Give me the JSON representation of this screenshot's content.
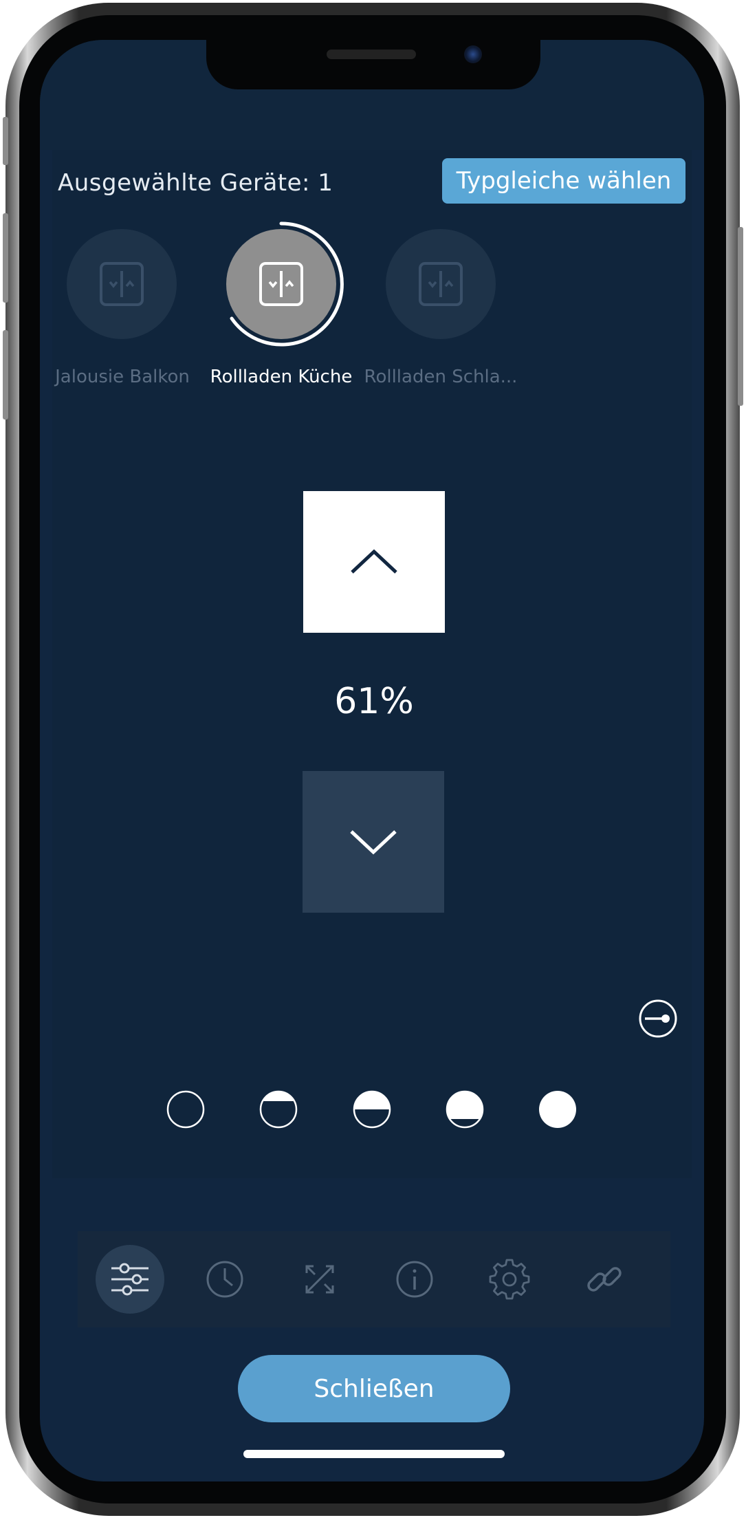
{
  "header": {
    "selected_count": "Ausgewählte Geräte: 1",
    "select_same_type_label": "Typgleiche wählen"
  },
  "devices": [
    {
      "label": "Jalousie Balkon",
      "selected": false,
      "icon": "shutter-icon"
    },
    {
      "label": "Rollladen Küche",
      "selected": true,
      "icon": "shutter-icon"
    },
    {
      "label": "Rollladen Schla...",
      "selected": false,
      "icon": "shutter-icon"
    }
  ],
  "control": {
    "position": "61%",
    "up_icon": "chevron-up-icon",
    "down_icon": "chevron-down-icon"
  },
  "presets": [
    {
      "name": "open",
      "fill": 0
    },
    {
      "name": "quarter",
      "fill": 0.25
    },
    {
      "name": "half",
      "fill": 0.5
    },
    {
      "name": "three-quarter",
      "fill": 0.75
    },
    {
      "name": "closed",
      "fill": 1
    }
  ],
  "toolbar": {
    "items": [
      {
        "icon": "sliders-icon",
        "active": true
      },
      {
        "icon": "clock-icon",
        "active": false
      },
      {
        "icon": "shuffle-icon",
        "active": false
      },
      {
        "icon": "info-icon",
        "active": false
      },
      {
        "icon": "gear-icon",
        "active": false
      },
      {
        "icon": "link-icon",
        "active": false
      }
    ]
  },
  "footer": {
    "close_label": "Schließen"
  },
  "colors": {
    "background": "#112640",
    "accent": "#5aa7d6",
    "button_dark": "#2a3f56",
    "inactive_text": "#5b6d83"
  }
}
